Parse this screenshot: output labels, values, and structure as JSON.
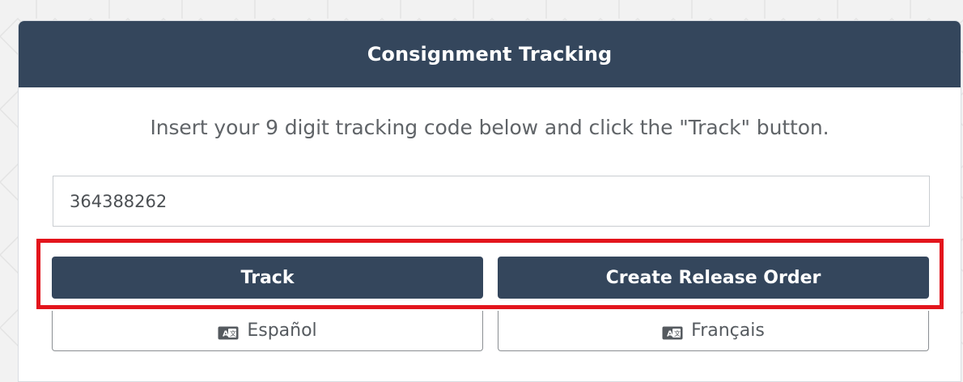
{
  "panel": {
    "title": "Consignment Tracking",
    "instruction": "Insert your 9 digit tracking code below and click the \"Track\" button."
  },
  "tracking_input": {
    "value": "364388262",
    "placeholder": ""
  },
  "buttons": {
    "track_label": "Track",
    "release_label": "Create Release Order"
  },
  "languages": [
    {
      "label": "Español",
      "icon": "language-icon"
    },
    {
      "label": "Français",
      "icon": "language-icon"
    }
  ],
  "colors": {
    "header_bg": "#34465c",
    "button_bg": "#34465c",
    "highlight": "#e3141c",
    "page_bg": "#f2f2f2"
  }
}
